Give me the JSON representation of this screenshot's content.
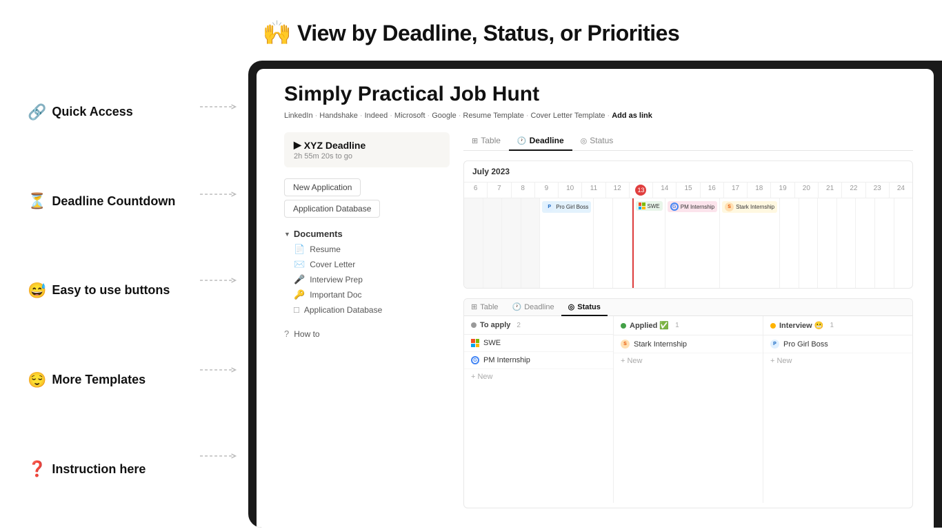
{
  "header": {
    "emoji": "🙌",
    "title": "View by Deadline, Status, or Priorities"
  },
  "left_labels": [
    {
      "id": "quick-access",
      "emoji": "🔗",
      "text": "Quick Access"
    },
    {
      "id": "deadline-countdown",
      "emoji": "⏳",
      "text": "Deadline Countdown"
    },
    {
      "id": "easy-buttons",
      "emoji": "😅",
      "text": "Easy to use buttons"
    },
    {
      "id": "more-templates",
      "emoji": "😌",
      "text": "More Templates"
    },
    {
      "id": "instruction",
      "emoji": "❓",
      "text": "Instruction here"
    }
  ],
  "page": {
    "title": "Simply Practical Job Hunt",
    "links": [
      {
        "label": "LinkedIn",
        "bold": false
      },
      {
        "label": "Handshake",
        "bold": false
      },
      {
        "label": "Indeed",
        "bold": false
      },
      {
        "label": "Microsoft",
        "bold": false
      },
      {
        "label": "Google",
        "bold": false
      },
      {
        "label": "Resume Template",
        "bold": false
      },
      {
        "label": "Cover Letter Template",
        "bold": false
      },
      {
        "label": "Add as link",
        "bold": true
      }
    ]
  },
  "deadline": {
    "title": "XYZ Deadline",
    "countdown": "2h 55m 20s to go"
  },
  "buttons": [
    {
      "label": "New Application"
    },
    {
      "label": "Application Database"
    }
  ],
  "documents": {
    "section_label": "Documents",
    "items": [
      {
        "icon": "📄",
        "label": "Resume"
      },
      {
        "icon": "✉️",
        "label": "Cover Letter"
      },
      {
        "icon": "🎤",
        "label": "Interview Prep"
      },
      {
        "icon": "🔑",
        "label": "Important Doc"
      },
      {
        "icon": "□",
        "label": "Application Database"
      }
    ]
  },
  "help": {
    "icon": "?",
    "label": "How to"
  },
  "calendar": {
    "month": "July 2023",
    "days": [
      6,
      7,
      8,
      9,
      10,
      11,
      12,
      13,
      14,
      15,
      16,
      17,
      18,
      19,
      20,
      21,
      22,
      23,
      24
    ],
    "today_day": 13,
    "events": [
      {
        "day_col": 13,
        "label": "SWE",
        "type": "ms",
        "color": "#e8f5e9"
      },
      {
        "day_col": 14,
        "label": "PM Internship",
        "type": "g",
        "color": "#fce4ec"
      },
      {
        "day_col": 15,
        "label": "Stark Internship",
        "type": "stark",
        "color": "#fff8e1"
      }
    ],
    "secondary_events": [
      {
        "day_col": 10,
        "label": "Pro Girl Boss",
        "type": "pro",
        "color": "#e3f2fd"
      }
    ]
  },
  "view_tabs_top": [
    {
      "label": "Table",
      "icon": "⊞",
      "active": false
    },
    {
      "label": "Deadline",
      "icon": "🕐",
      "active": true
    },
    {
      "label": "Status",
      "icon": "◎",
      "active": false
    }
  ],
  "view_tabs_bottom": [
    {
      "label": "Table",
      "icon": "⊞",
      "active": false
    },
    {
      "label": "Deadline",
      "icon": "🕐",
      "active": false
    },
    {
      "label": "Status",
      "icon": "◎",
      "active": true
    }
  ],
  "board": {
    "columns": [
      {
        "id": "to-apply",
        "label": "To apply",
        "count": 2,
        "dot_color": "#999",
        "cards": [
          {
            "label": "SWE",
            "type": "ms"
          },
          {
            "label": "PM Internship",
            "type": "g"
          }
        ]
      },
      {
        "id": "applied",
        "label": "Applied ✅",
        "count": 1,
        "dot_color": "#43a047",
        "cards": [
          {
            "label": "Stark Internship",
            "type": "stark"
          }
        ]
      },
      {
        "id": "interview",
        "label": "Interview 😬",
        "count": 1,
        "dot_color": "#ffb300",
        "cards": [
          {
            "label": "Pro Girl Boss",
            "type": "pro"
          }
        ]
      }
    ]
  }
}
